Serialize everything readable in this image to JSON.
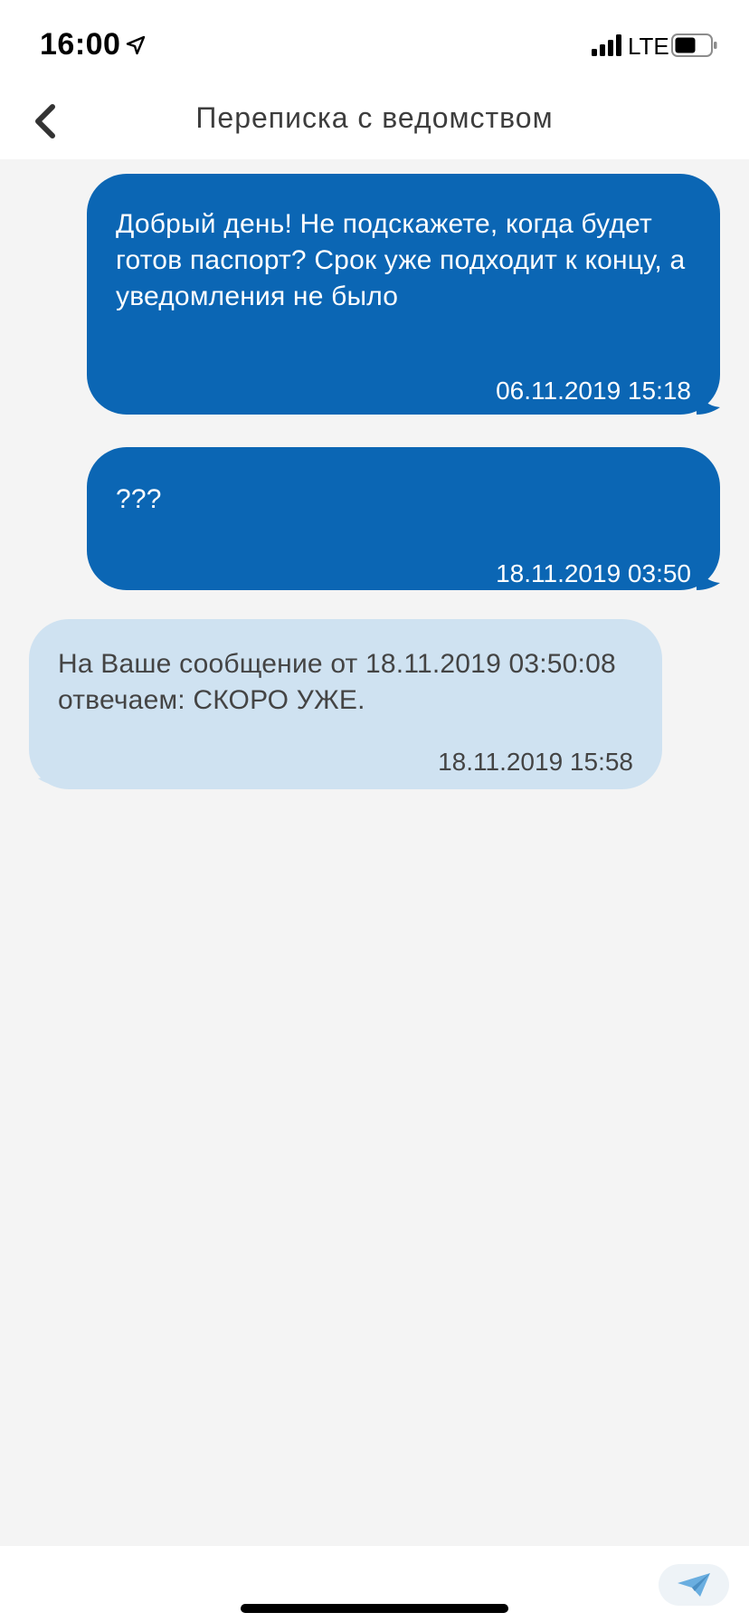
{
  "status_bar": {
    "time": "16:00",
    "network": "LTE",
    "location_icon": "location-arrow-icon",
    "signal_icon": "cellular-signal-icon",
    "battery_icon": "battery-icon"
  },
  "header": {
    "title": "Переписка с ведомством",
    "back_icon": "chevron-left-icon"
  },
  "messages": [
    {
      "direction": "outgoing",
      "text": "Добрый день! Не подскажете, когда будет готов паспорт? Срок уже подходит к концу, а уведомления не было",
      "timestamp": "06.11.2019 15:18"
    },
    {
      "direction": "outgoing",
      "text": "???",
      "timestamp": "18.11.2019 03:50"
    },
    {
      "direction": "incoming",
      "text": "На Ваше сообщение от 18.11.2019 03:50:08 отвечаем: СКОРО УЖЕ.",
      "timestamp": "18.11.2019 15:58"
    }
  ],
  "composer": {
    "send_icon": "paper-plane-icon"
  },
  "colors": {
    "outgoing_bubble": "#0b66b4",
    "incoming_bubble": "#cfe2f1",
    "background": "#f4f4f4",
    "send_icon": "#6aaee0"
  }
}
